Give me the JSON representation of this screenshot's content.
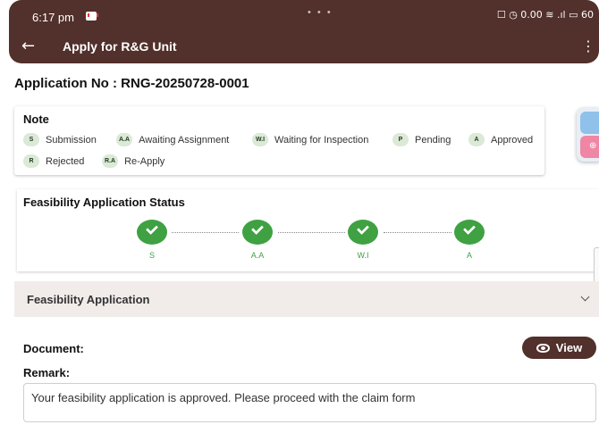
{
  "status_bar": {
    "time": "6:17 pm",
    "icons": "☐ ◷ 0.00 ≋ .ıl ▭ 60",
    "battery": "60"
  },
  "app_bar": {
    "back_icon": "arrow-left-icon",
    "title": "Apply for R&G Unit",
    "more_icon": "more-vert-icon"
  },
  "application": {
    "label": "Application No :",
    "number": "RNG-20250728-0001"
  },
  "note": {
    "title": "Note",
    "legend": [
      {
        "code": "S",
        "label": "Submission"
      },
      {
        "code": "A.A",
        "label": "Awaiting Assignment"
      },
      {
        "code": "W.I",
        "label": "Waiting for Inspection"
      },
      {
        "code": "P",
        "label": "Pending"
      },
      {
        "code": "A",
        "label": "Approved"
      },
      {
        "code": "R",
        "label": "Rejected"
      },
      {
        "code": "R.A",
        "label": "Re-Apply"
      }
    ]
  },
  "status": {
    "title": "Feasibility Application Status",
    "steps": [
      {
        "label": "S",
        "done": true
      },
      {
        "label": "A.A",
        "done": true
      },
      {
        "label": "W.I",
        "done": true
      },
      {
        "label": "A",
        "done": true
      }
    ]
  },
  "feasibility": {
    "title": "Feasibility Application",
    "expanded": true
  },
  "document": {
    "label": "Document:",
    "view_button": "View",
    "remark_label": "Remark:",
    "remark_text": "Your feasibility application is approved. Please proceed with the claim form"
  },
  "colors": {
    "brand": "#52302b",
    "step_done": "#3fa142",
    "chip_bg": "#dbe9d6",
    "accordion_bg": "#f1ecea"
  }
}
